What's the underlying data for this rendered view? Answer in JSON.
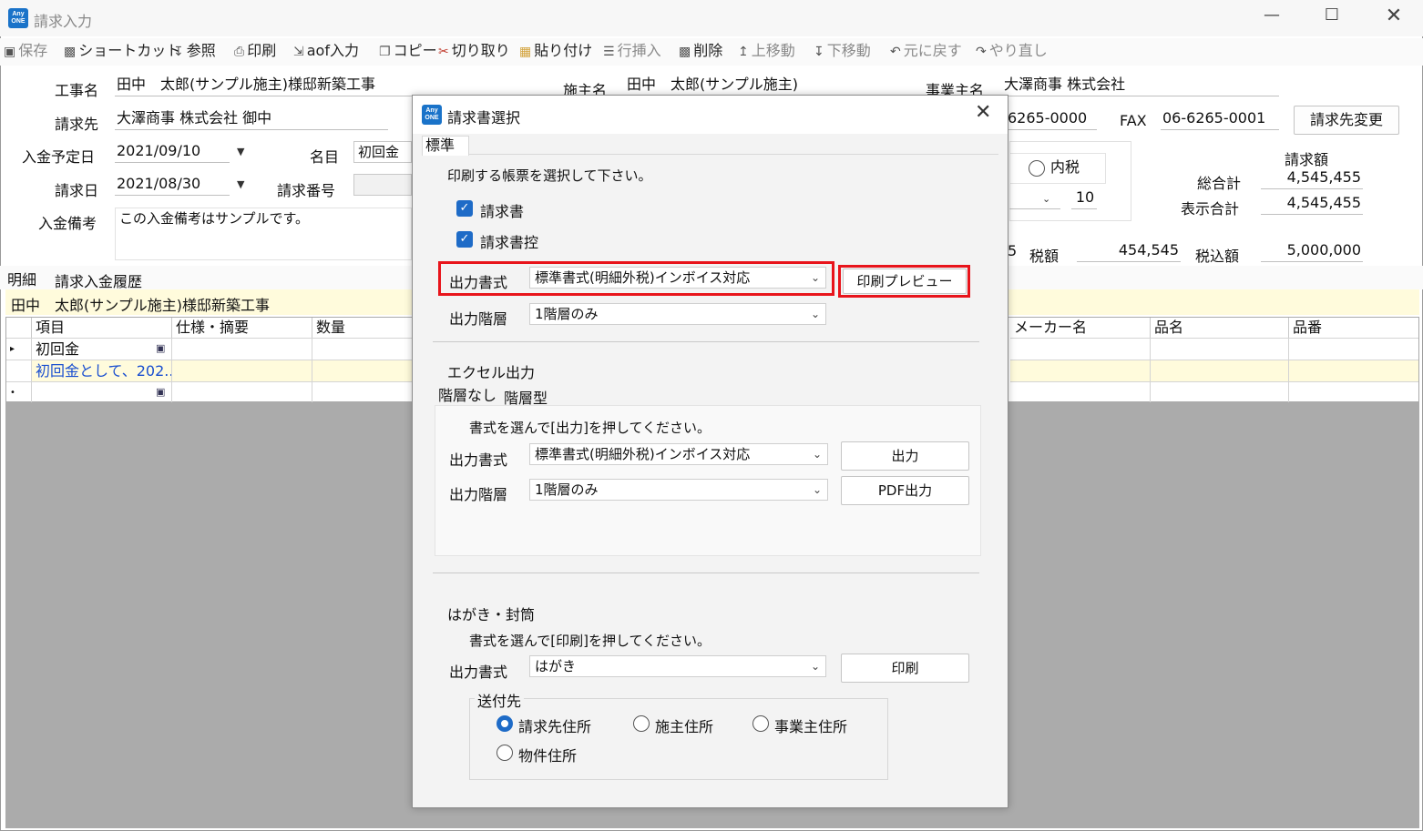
{
  "window": {
    "title": "請求入力",
    "app_badge": "Any ONE"
  },
  "toolbar": {
    "save": "保存",
    "shortcut": "ショートカット",
    "reference": "参照",
    "print": "印刷",
    "aof_input": "aof入力",
    "copy": "コピー",
    "cut": "切り取り",
    "paste": "貼り付け",
    "insert_row": "行挿入",
    "delete": "削除",
    "move_up": "上移動",
    "move_down": "下移動",
    "undo": "元に戻す",
    "redo": "やり直し"
  },
  "form": {
    "construction_label": "工事名",
    "construction_value": "田中　太郎(サンプル施主)様邸新築工事",
    "owner_label": "施主名",
    "owner_value": "田中　太郎(サンプル施主)",
    "business_label": "事業主名",
    "business_value": "大澤商事 株式会社",
    "billto_label": "請求先",
    "billto_value": "大澤商事 株式会社 御中",
    "tel_value": "6265-0000",
    "fax_label": "FAX",
    "fax_value": "06-6265-0001",
    "change_billto": "請求先変更",
    "due_label": "入金予定日",
    "due_value": "2021/09/10",
    "item_label": "名目",
    "item_value": "初回金",
    "bill_date_label": "請求日",
    "bill_date_value": "2021/08/30",
    "bill_no_label": "請求番号",
    "note_label": "入金備考",
    "note_value": "この入金備考はサンプルです。",
    "tax_incl": "内税",
    "rate_value": "10",
    "amount_header": "請求額",
    "total_label": "総合計",
    "total_value": "4,545,455",
    "display_total_label": "表示合計",
    "display_total_value": "4,545,455",
    "five_fragment": "5",
    "tax_label": "税額",
    "tax_value": "454,545",
    "with_tax_label": "税込額",
    "with_tax_value": "5,000,000"
  },
  "tabs": {
    "detail": "明細",
    "history": "請求入金履歴"
  },
  "project_banner": "田中　太郎(サンプル施主)様邸新築工事",
  "grid": {
    "headers": {
      "item": "項目",
      "spec": "仕様・摘要",
      "qty": "数量",
      "maker": "メーカー名",
      "product": "品名",
      "product_no": "品番"
    },
    "row1_item": "初回金",
    "row2_item": "初回金として、202..."
  },
  "dialog": {
    "title": "請求書選択",
    "tab": "標準",
    "instruction": "印刷する帳票を選択して下さい。",
    "check_invoice": "請求書",
    "check_invoice_copy": "請求書控",
    "format_label": "出力書式",
    "format_value": "標準書式(明細外税)インボイス対応",
    "preview_button": "印刷プレビュー",
    "level_label": "出力階層",
    "level_value": "1階層のみ",
    "excel_title": "エクセル出力",
    "excel_tab_flat": "階層なし",
    "excel_tab_tree": "階層型",
    "excel_instruction": "書式を選んで[出力]を押してください。",
    "excel_format_label": "出力書式",
    "excel_format_value": "標準書式(明細外税)インボイス対応",
    "excel_output_button": "出力",
    "excel_level_label": "出力階層",
    "excel_level_value": "1階層のみ",
    "pdf_button": "PDF出力",
    "postcard_title": "はがき・封筒",
    "postcard_instruction": "書式を選んで[印刷]を押してください。",
    "postcard_format_label": "出力書式",
    "postcard_format_value": "はがき",
    "postcard_print_button": "印刷",
    "send_to_title": "送付先",
    "radio_billto": "請求先住所",
    "radio_owner": "施主住所",
    "radio_business": "事業主住所",
    "radio_property": "物件住所"
  },
  "colors": {
    "accent": "#1e6bc7",
    "highlight": "#e8141b",
    "banner": "#fffbdc"
  }
}
